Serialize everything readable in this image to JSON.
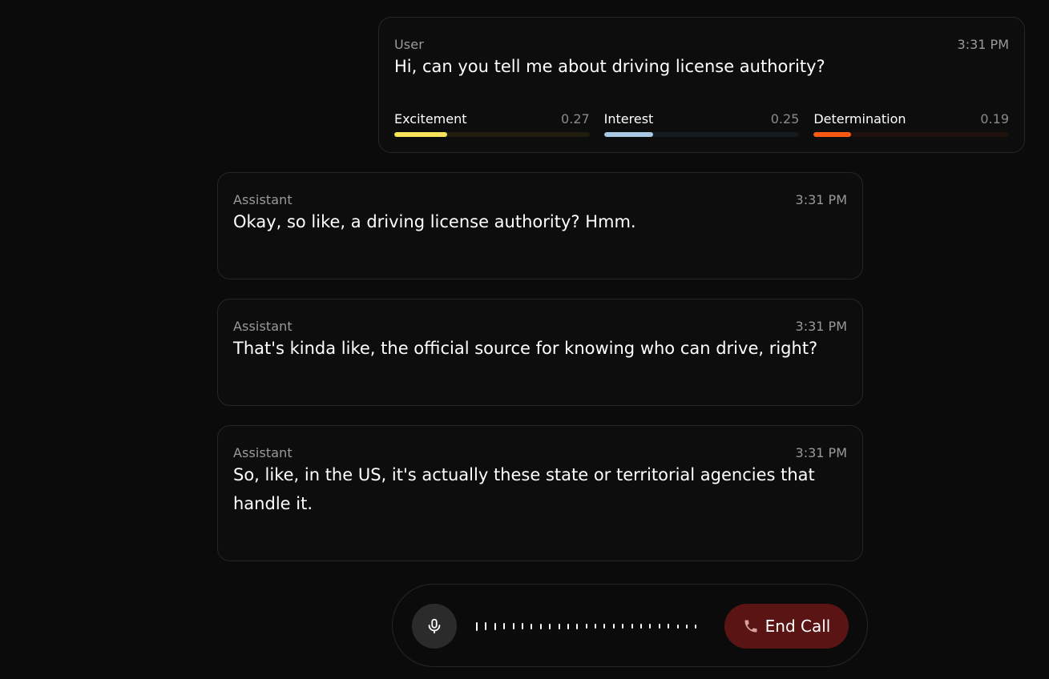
{
  "messages": {
    "user": {
      "role": "User",
      "time": "3:31 PM",
      "text": "Hi, can you tell me about driving license authority?",
      "emotions": [
        {
          "name": "Excitement",
          "score": "0.27",
          "level": 0.27,
          "color": "#f7e35c",
          "track": "#1f1d0e"
        },
        {
          "name": "Interest",
          "score": "0.25",
          "level": 0.25,
          "color": "#a9c8e4",
          "track": "#161b22"
        },
        {
          "name": "Determination",
          "score": "0.19",
          "level": 0.19,
          "color": "#ff5a0f",
          "track": "#1f120d"
        }
      ]
    },
    "a1": {
      "role": "Assistant",
      "time": "3:31 PM",
      "text": "Okay, so like, a driving license authority? Hmm."
    },
    "a2": {
      "role": "Assistant",
      "time": "3:31 PM",
      "text": "That's kinda like, the official source for knowing who can drive, right?"
    },
    "a3": {
      "role": "Assistant",
      "time": "3:31 PM",
      "text": "So, like, in the US, it's actually these state or territorial agencies that handle it."
    }
  },
  "controls": {
    "mic_icon": "microphone-icon",
    "waveform_levels": [
      0.7,
      0.6,
      0.55,
      0.5,
      0.5,
      0.5,
      0.45,
      0.45,
      0.45,
      0.45,
      0.45,
      0.45,
      0.4,
      0.4,
      0.4,
      0.4,
      0.4,
      0.4,
      0.35,
      0.35,
      0.35,
      0.35,
      0.3,
      0.3,
      0.3
    ],
    "end_call_label": "End Call",
    "end_call_icon": "phone-icon"
  }
}
